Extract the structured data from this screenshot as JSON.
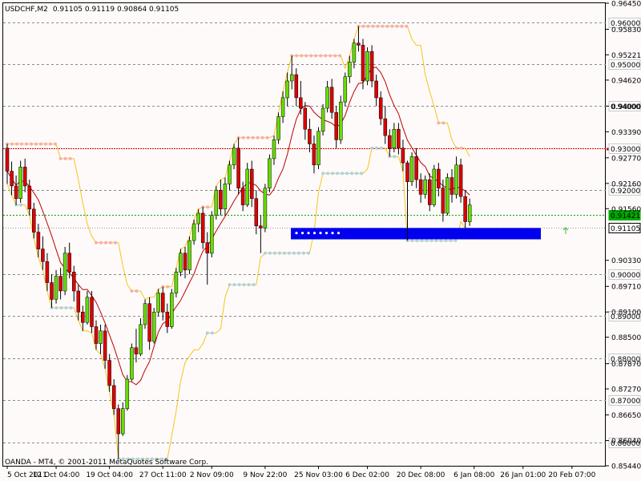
{
  "header": {
    "symbol": "USDCHF,M2",
    "ohlc": "0.91105 0.91119 0.90864 0.91105"
  },
  "footer": {
    "copyright": "OANDA - MT4, © 2001-2011 MetaQuotes Software Corp."
  },
  "colors": {
    "background": "#fffafa",
    "frame": "#000000",
    "grid": "#8a8a8a",
    "bull": "#66dd00",
    "bear": "#dd0000",
    "ma": "#bb0000",
    "channel": "#f5c518",
    "resistance_dots": "#f4b0b0",
    "support_dots": "#a8d4e6",
    "zone": "#0000ee",
    "level_red": "#cc0000",
    "level_green": "#00aa00"
  },
  "chart_data": {
    "type": "candlestick",
    "title": "USDCHF,M2",
    "ylim": [
      0.8544,
      0.9645
    ],
    "price_ticks": [
      "0.96450",
      "0.95830",
      "0.95221",
      "0.94620",
      "0.94000",
      "0.93390",
      "0.92770",
      "0.92160",
      "0.91560",
      "0.90330",
      "0.89710",
      "0.89100",
      "0.88500",
      "0.87870",
      "0.87270",
      "0.86650",
      "0.86040",
      "0.85440"
    ],
    "level_labels": [
      {
        "value": "0.96000",
        "price": 0.96,
        "kind": "level"
      },
      {
        "value": "0.95000",
        "price": 0.95,
        "kind": "level"
      },
      {
        "value": "0.94000",
        "price": 0.94,
        "kind": "level"
      },
      {
        "value": "0.93000",
        "price": 0.93,
        "kind": "red"
      },
      {
        "value": "0.92000",
        "price": 0.92,
        "kind": "level"
      },
      {
        "value": "0.91421",
        "price": 0.91421,
        "kind": "green"
      },
      {
        "value": "0.91105",
        "price": 0.91105,
        "kind": "current"
      },
      {
        "value": "0.90000",
        "price": 0.9,
        "kind": "level"
      },
      {
        "value": "0.89000",
        "price": 0.89,
        "kind": "level"
      },
      {
        "value": "0.88000",
        "price": 0.88,
        "kind": "level"
      },
      {
        "value": "0.87000",
        "price": 0.87,
        "kind": "level"
      },
      {
        "value": "0.86000",
        "price": 0.86,
        "kind": "level"
      }
    ],
    "time_labels": [
      {
        "label": "5 Oct 2011",
        "index": 0
      },
      {
        "label": "12 Oct 04:00",
        "index": 11
      },
      {
        "label": "19 Oct 04:00",
        "index": 23
      },
      {
        "label": "27 Oct 11:00",
        "index": 35
      },
      {
        "label": "2 Nov 09:00",
        "index": 46
      },
      {
        "label": "9 Nov 22:00",
        "index": 58
      },
      {
        "label": "25 Nov 03:00",
        "index": 70
      },
      {
        "label": "6 Dec 02:00",
        "index": 81
      },
      {
        "label": "20 Dec 08:00",
        "index": 93
      },
      {
        "label": "6 Jan 08:00",
        "index": 105
      },
      {
        "label": "26 Jan 01:00",
        "index": 116
      },
      {
        "label": "20 Feb 07:00",
        "index": 127
      }
    ],
    "candles": [
      [
        0.93,
        0.931,
        0.9215,
        0.9245
      ],
      [
        0.9245,
        0.9268,
        0.9188,
        0.921
      ],
      [
        0.921,
        0.9235,
        0.9165,
        0.918
      ],
      [
        0.918,
        0.927,
        0.917,
        0.9255
      ],
      [
        0.9255,
        0.9275,
        0.9195,
        0.921
      ],
      [
        0.921,
        0.9225,
        0.914,
        0.9155
      ],
      [
        0.9155,
        0.917,
        0.9085,
        0.91
      ],
      [
        0.91,
        0.912,
        0.904,
        0.906
      ],
      [
        0.906,
        0.909,
        0.901,
        0.903
      ],
      [
        0.903,
        0.905,
        0.896,
        0.898
      ],
      [
        0.898,
        0.9,
        0.892,
        0.894
      ],
      [
        0.894,
        0.901,
        0.893,
        0.8995
      ],
      [
        0.8995,
        0.9015,
        0.894,
        0.896
      ],
      [
        0.896,
        0.9065,
        0.895,
        0.905
      ],
      [
        0.905,
        0.9075,
        0.899,
        0.9005
      ],
      [
        0.9005,
        0.902,
        0.8935,
        0.896
      ],
      [
        0.896,
        0.8975,
        0.889,
        0.891
      ],
      [
        0.891,
        0.8925,
        0.8865,
        0.8885
      ],
      [
        0.8885,
        0.896,
        0.888,
        0.8945
      ],
      [
        0.8945,
        0.896,
        0.886,
        0.8875
      ],
      [
        0.8875,
        0.889,
        0.882,
        0.8835
      ],
      [
        0.8835,
        0.888,
        0.881,
        0.8865
      ],
      [
        0.8865,
        0.888,
        0.8775,
        0.8795
      ],
      [
        0.8795,
        0.881,
        0.872,
        0.8735
      ],
      [
        0.8735,
        0.875,
        0.8665,
        0.868
      ],
      [
        0.868,
        0.869,
        0.856,
        0.862
      ],
      [
        0.862,
        0.8695,
        0.8615,
        0.868
      ],
      [
        0.868,
        0.876,
        0.8675,
        0.875
      ],
      [
        0.875,
        0.8835,
        0.8745,
        0.8825
      ],
      [
        0.8825,
        0.887,
        0.879,
        0.881
      ],
      [
        0.881,
        0.8895,
        0.8805,
        0.888
      ],
      [
        0.888,
        0.894,
        0.887,
        0.893
      ],
      [
        0.893,
        0.8945,
        0.882,
        0.884
      ],
      [
        0.884,
        0.892,
        0.8835,
        0.891
      ],
      [
        0.891,
        0.8965,
        0.89,
        0.8955
      ],
      [
        0.8955,
        0.897,
        0.889,
        0.891
      ],
      [
        0.891,
        0.893,
        0.886,
        0.8875
      ],
      [
        0.8875,
        0.8965,
        0.887,
        0.8955
      ],
      [
        0.8955,
        0.9015,
        0.8945,
        0.9005
      ],
      [
        0.9005,
        0.906,
        0.8995,
        0.905
      ],
      [
        0.905,
        0.9065,
        0.899,
        0.901
      ],
      [
        0.901,
        0.909,
        0.9,
        0.908
      ],
      [
        0.908,
        0.913,
        0.907,
        0.912
      ],
      [
        0.912,
        0.9155,
        0.91,
        0.9145
      ],
      [
        0.9145,
        0.916,
        0.906,
        0.9075
      ],
      [
        0.9075,
        0.91,
        0.8975,
        0.905
      ],
      [
        0.905,
        0.915,
        0.904,
        0.914
      ],
      [
        0.914,
        0.921,
        0.913,
        0.92
      ],
      [
        0.92,
        0.9225,
        0.914,
        0.9155
      ],
      [
        0.9155,
        0.923,
        0.914,
        0.9215
      ],
      [
        0.9215,
        0.927,
        0.92,
        0.926
      ],
      [
        0.926,
        0.931,
        0.925,
        0.93
      ],
      [
        0.93,
        0.9325,
        0.919,
        0.9205
      ],
      [
        0.9205,
        0.922,
        0.915,
        0.9165
      ],
      [
        0.9165,
        0.9265,
        0.916,
        0.925
      ],
      [
        0.925,
        0.927,
        0.916,
        0.918
      ],
      [
        0.918,
        0.92,
        0.9095,
        0.9115
      ],
      [
        0.9115,
        0.914,
        0.905,
        0.911
      ],
      [
        0.911,
        0.9215,
        0.91,
        0.9205
      ],
      [
        0.9205,
        0.9285,
        0.9195,
        0.9275
      ],
      [
        0.9275,
        0.933,
        0.926,
        0.932
      ],
      [
        0.932,
        0.9385,
        0.931,
        0.9375
      ],
      [
        0.9375,
        0.9435,
        0.936,
        0.942
      ],
      [
        0.942,
        0.948,
        0.94,
        0.946
      ],
      [
        0.946,
        0.952,
        0.944,
        0.9475
      ],
      [
        0.9475,
        0.949,
        0.94,
        0.942
      ],
      [
        0.942,
        0.946,
        0.938,
        0.9395
      ],
      [
        0.9395,
        0.941,
        0.932,
        0.9345
      ],
      [
        0.9345,
        0.937,
        0.929,
        0.931
      ],
      [
        0.931,
        0.933,
        0.924,
        0.926
      ],
      [
        0.926,
        0.935,
        0.925,
        0.934
      ],
      [
        0.934,
        0.9405,
        0.933,
        0.9395
      ],
      [
        0.9395,
        0.946,
        0.9385,
        0.9445
      ],
      [
        0.9445,
        0.9465,
        0.937,
        0.9385
      ],
      [
        0.9385,
        0.94,
        0.93,
        0.932
      ],
      [
        0.932,
        0.9425,
        0.931,
        0.941
      ],
      [
        0.941,
        0.948,
        0.94,
        0.947
      ],
      [
        0.947,
        0.952,
        0.9455,
        0.9505
      ],
      [
        0.9505,
        0.956,
        0.949,
        0.955
      ],
      [
        0.955,
        0.959,
        0.953,
        0.9545
      ],
      [
        0.9545,
        0.956,
        0.944,
        0.946
      ],
      [
        0.946,
        0.954,
        0.945,
        0.953
      ],
      [
        0.953,
        0.9545,
        0.9445,
        0.946
      ],
      [
        0.946,
        0.9475,
        0.94,
        0.942
      ],
      [
        0.942,
        0.9435,
        0.9355,
        0.937
      ],
      [
        0.937,
        0.94,
        0.931,
        0.933
      ],
      [
        0.933,
        0.9345,
        0.928,
        0.93
      ],
      [
        0.93,
        0.936,
        0.929,
        0.9345
      ],
      [
        0.9345,
        0.936,
        0.9285,
        0.93
      ],
      [
        0.93,
        0.932,
        0.9245,
        0.9265
      ],
      [
        0.9265,
        0.927,
        0.908,
        0.922
      ],
      [
        0.922,
        0.929,
        0.921,
        0.928
      ],
      [
        0.928,
        0.93,
        0.9205,
        0.9225
      ],
      [
        0.9225,
        0.924,
        0.917,
        0.919
      ],
      [
        0.919,
        0.9235,
        0.918,
        0.9225
      ],
      [
        0.9225,
        0.924,
        0.915,
        0.9165
      ],
      [
        0.9165,
        0.926,
        0.916,
        0.925
      ],
      [
        0.925,
        0.9265,
        0.9185,
        0.9205
      ],
      [
        0.9205,
        0.9225,
        0.9125,
        0.9145
      ],
      [
        0.9145,
        0.924,
        0.914,
        0.923
      ],
      [
        0.923,
        0.925,
        0.917,
        0.919
      ],
      [
        0.919,
        0.928,
        0.918,
        0.926
      ],
      [
        0.926,
        0.9275,
        0.917,
        0.9185
      ],
      [
        0.9185,
        0.92,
        0.911,
        0.9125
      ],
      [
        0.9125,
        0.918,
        0.9115,
        0.9165
      ]
    ]
  }
}
